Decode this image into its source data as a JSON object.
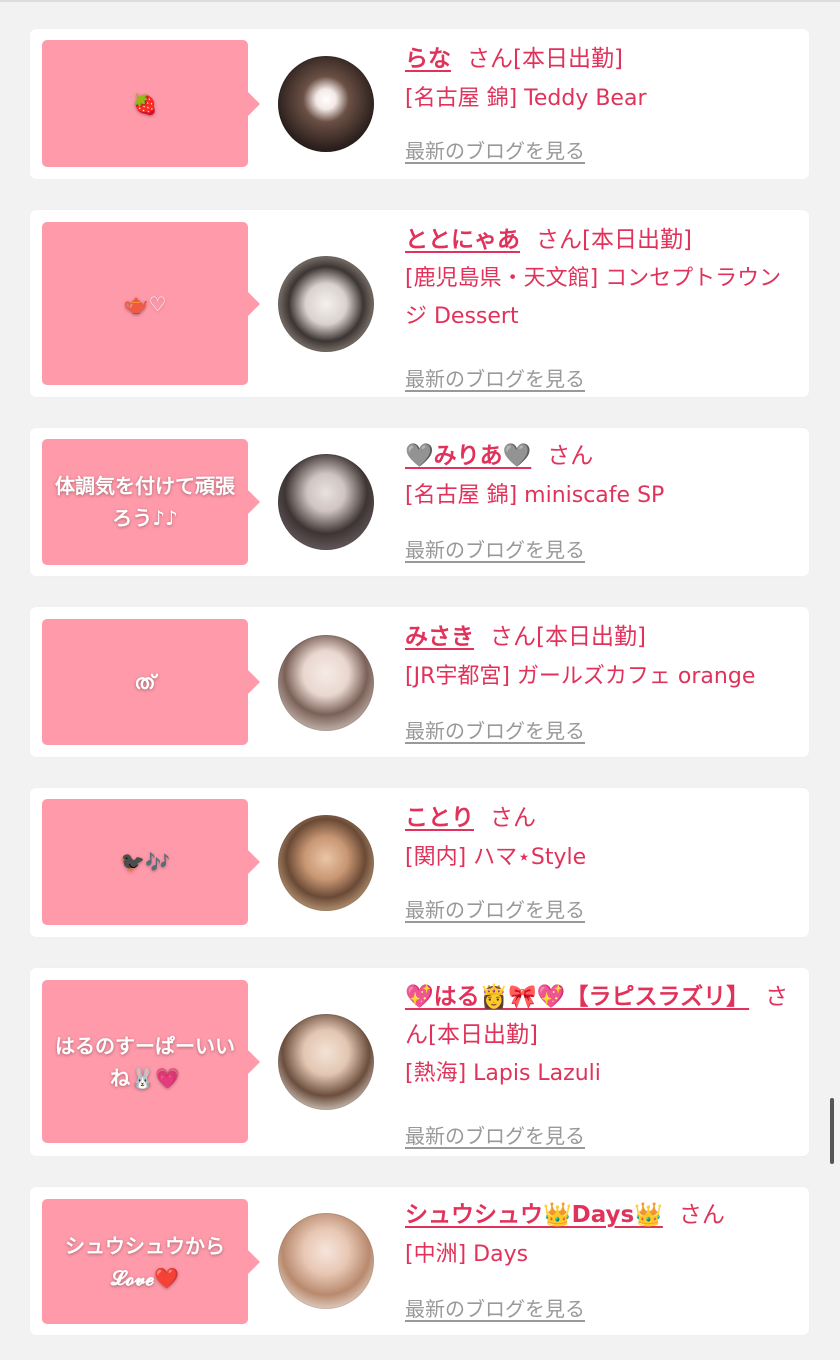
{
  "blog_link_label": "最新のブログを見る",
  "san_label": "さん",
  "cards": [
    {
      "bubble": "🍓",
      "name": "らな",
      "status": "[本日出勤]",
      "shop": "[名古屋 錦] Teddy Bear"
    },
    {
      "bubble": "🫖♡",
      "name": "ととにゃあ",
      "status": "[本日出勤]",
      "shop": "[鹿児島県・天文館] コンセプトラウンジ Dessert"
    },
    {
      "bubble": "体調気を付けて頑張ろう♪♪",
      "name": "🩶みりあ🩶",
      "status": "",
      "shop": "[名古屋 錦] miniscafe SP"
    },
    {
      "bubble": "ത്",
      "name": "みさき",
      "status": "[本日出勤]",
      "shop": "[JR宇都宮] ガールズカフェ orange"
    },
    {
      "bubble": "🐦‍⬛🎶",
      "name": "ことり",
      "status": "",
      "shop": "[関内] ハマ⋆Style"
    },
    {
      "bubble": "はるのすーぱーいいね🐰💗",
      "name": "💖はる👸🎀💖【ラピスラズリ】",
      "status": "[本日出勤]",
      "shop": "[熱海] Lapis Lazuli"
    },
    {
      "bubble": "シュウシュウから𝓛𝓸𝓿𝓮❤️",
      "name": "シュウシュウ👑Days👑",
      "status": "",
      "shop": "[中洲] Days"
    }
  ],
  "colors": {
    "accent": "#e0325a",
    "bubble": "#ff9aaa",
    "link_gray": "#999999"
  }
}
